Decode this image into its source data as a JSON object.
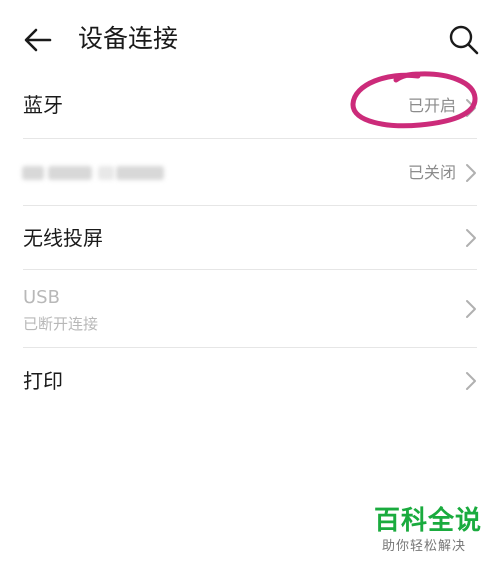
{
  "header": {
    "title": "设备连接"
  },
  "rows": [
    {
      "label": "蓝牙",
      "status": "已开启"
    },
    {
      "label": "",
      "status": "已关闭"
    },
    {
      "label": "无线投屏",
      "status": ""
    },
    {
      "label": "USB",
      "sublabel": "已断开连接",
      "status": ""
    },
    {
      "label": "打印",
      "status": ""
    }
  ],
  "annotation": {
    "color": "#cc2b7a"
  },
  "watermark": {
    "title": "百科全说",
    "subtitle": "助你轻松解决"
  },
  "colors": {
    "accent": "#1aab3e",
    "muted": "#8c8c8c",
    "disabled": "#b8b8b8"
  }
}
